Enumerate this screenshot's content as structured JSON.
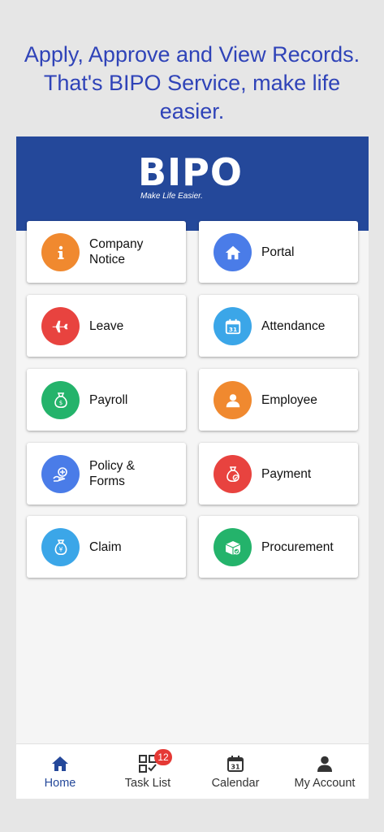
{
  "promo": {
    "line1": "Apply, Approve and View Records.",
    "line2": "That's BIPO Service, make life",
    "line3": "easier."
  },
  "header": {
    "logo_text": "BIPO",
    "tagline": "Make Life Easier."
  },
  "modules": [
    {
      "label": "Company\nNotice",
      "icon": "info-icon",
      "color": "#f0892f"
    },
    {
      "label": "Portal",
      "icon": "home-icon",
      "color": "#4a7ce8"
    },
    {
      "label": "Leave",
      "icon": "airplane-icon",
      "color": "#e8433f"
    },
    {
      "label": "Attendance",
      "icon": "calendar-icon",
      "color": "#3ba6e8"
    },
    {
      "label": "Payroll",
      "icon": "money-bag-icon",
      "color": "#24b36b"
    },
    {
      "label": "Employee",
      "icon": "person-icon",
      "color": "#f0892f"
    },
    {
      "label": "Policy &\nForms",
      "icon": "policy-icon",
      "color": "#4a7ce8"
    },
    {
      "label": "Payment",
      "icon": "payment-bag-icon",
      "color": "#e8433f"
    },
    {
      "label": "Claim",
      "icon": "claim-icon",
      "color": "#3ba6e8"
    },
    {
      "label": "Procurement",
      "icon": "box-icon",
      "color": "#24b36b"
    }
  ],
  "nav": {
    "home": "Home",
    "task_list": "Task List",
    "task_badge": "12",
    "calendar": "Calendar",
    "calendar_day": "31",
    "my_account": "My Account",
    "active_color": "#24489a"
  }
}
